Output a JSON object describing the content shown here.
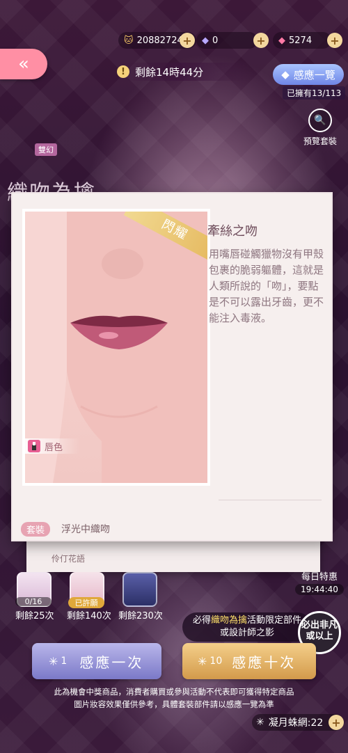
{
  "currencies": [
    {
      "icon": "cat-coin-icon",
      "value": "20882724"
    },
    {
      "icon": "purple-diamond-icon",
      "value": "0"
    },
    {
      "icon": "pink-diamond-icon",
      "value": "5274"
    }
  ],
  "back": {
    "icon": "double-chevron-left-icon"
  },
  "timer": {
    "text": "剩餘14時44分"
  },
  "gallery": {
    "label": "感應一覽",
    "owned": "已擁有13/113"
  },
  "preview": {
    "label": "預覽套裝"
  },
  "pool": {
    "badge": "雙幻",
    "title": "織吻為擒"
  },
  "modal": {
    "ribbon": "閃耀",
    "tag_label": "唇色",
    "item_name": "牽絲之吻",
    "description": "用嘴唇碰觸獵物沒有甲殼包裹的脆弱軀體，這就是人類所說的「吻」，要點是不可以露出牙齒，更不能注入毒液。",
    "set_tag": "套裝",
    "set_name": "浮光中織吻",
    "under_text": "伶仃花語"
  },
  "daily": {
    "label": "每日特惠",
    "time": "19:44:40"
  },
  "rewards": [
    {
      "caption": "0/16",
      "remain": "剩餘25次"
    },
    {
      "caption": "已許願",
      "remain": "剩餘140次"
    },
    {
      "caption": "",
      "remain": "剩餘230次"
    }
  ],
  "promo": {
    "line1_pre": "必得",
    "line1_hl": "織吻為擒",
    "line1_post": "活動限定部件",
    "line2": "或設計師之影"
  },
  "stamp": {
    "text": "必出非凡或以上"
  },
  "buttons": {
    "one": {
      "count": "1",
      "label": "感應一次"
    },
    "ten": {
      "count": "10",
      "label": "感應十次"
    }
  },
  "disclaimer": {
    "line1": "此為機會中獎商品，消費者購買或參與活動不代表即可獲得特定商品",
    "line2": "圖片妝容效果僅供參考，具體套裝部件請以感應一覽為準"
  },
  "web_currency": {
    "label": "凝月蛛網:22"
  },
  "colors": {
    "accent_pink": "#ff8fa4",
    "gold": "#e5b85e",
    "lavender": "#7b79c8"
  }
}
